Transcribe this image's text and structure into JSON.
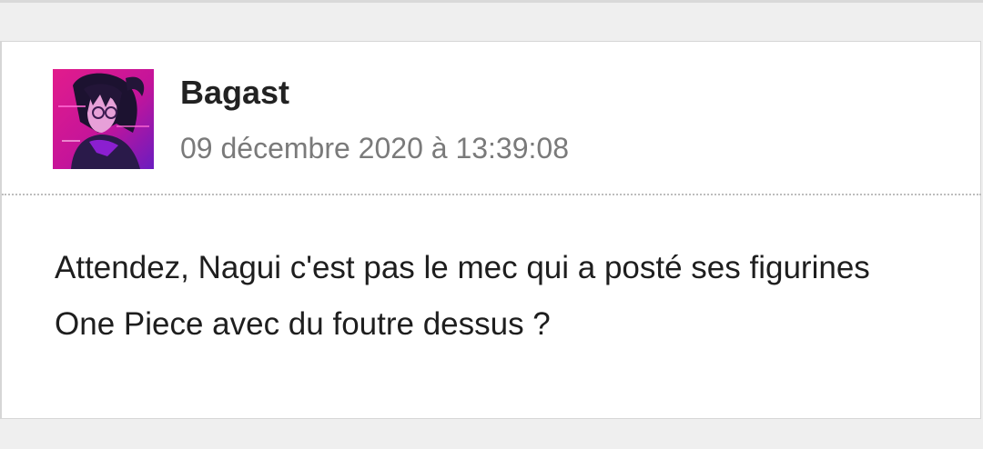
{
  "post": {
    "author": "Bagast",
    "timestamp": "09 décembre 2020 à 13:39:08",
    "message": "Attendez, Nagui c'est pas le mec qui a posté ses figurines One Piece avec du foutre dessus ?"
  },
  "avatar": {
    "icon": "anime-character-avatar",
    "colors": {
      "background": "#e21c8c",
      "accent": "#8b1fd0",
      "hair": "#1c1230"
    }
  }
}
